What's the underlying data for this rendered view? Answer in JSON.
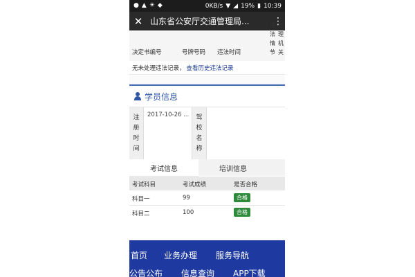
{
  "status_bar": {
    "net_speed": "0KB/s",
    "battery": "19%",
    "time": "10:39"
  },
  "app_bar": {
    "close_icon": "close-icon",
    "title": "山东省公安厅交通管理局...",
    "more_icon": "more-vertical-icon"
  },
  "violations": {
    "headers": [
      "决定书编号",
      "号牌号码",
      "违法时间",
      "违法情节",
      "处理机关"
    ],
    "empty_text": "无未处理违法记录，",
    "history_link": "查看历史违法记录"
  },
  "student_info": {
    "title": "学员信息",
    "register_label": "注册时间",
    "register_value": "2017-10-26 ...",
    "school_label": "驾校名称",
    "school_value": ""
  },
  "tabs": [
    {
      "label": "考试信息",
      "active": true
    },
    {
      "label": "培训信息",
      "active": false
    }
  ],
  "exam_table": {
    "headers": [
      "考试科目",
      "考试成绩",
      "是否合格"
    ],
    "rows": [
      {
        "subject": "科目一",
        "score": "99",
        "pass": "合格"
      },
      {
        "subject": "科目二",
        "score": "100",
        "pass": "合格"
      }
    ],
    "pass_color": "#2f8a3c"
  },
  "footer": {
    "items": [
      "首页",
      "业务办理",
      "服务导航",
      "公告公布",
      "信息查询",
      "APP下载"
    ],
    "background": "#1e3aa0"
  }
}
